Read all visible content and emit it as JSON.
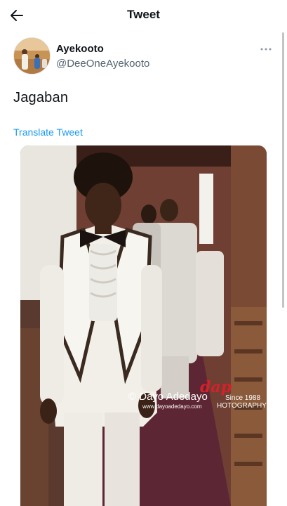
{
  "header": {
    "title": "Tweet",
    "back_icon": "arrow-left-icon"
  },
  "tweet": {
    "author": {
      "display_name": "Ayekooto",
      "handle": "@DeeOneAyekooto"
    },
    "more_icon": "more-horizontal-icon",
    "text": "Jagaban",
    "translate_label": "Translate Tweet"
  },
  "photo": {
    "watermark": {
      "name": "Dayo Adedayo",
      "copyright": "©",
      "url": "www.dayoadedayo.com",
      "since": "Since 1988",
      "photography": "HOTOGRAPHY",
      "logo_text": "dap"
    }
  },
  "colors": {
    "link": "#1d9bf0",
    "secondary_text": "#536471",
    "logo_red": "#d6202a"
  }
}
